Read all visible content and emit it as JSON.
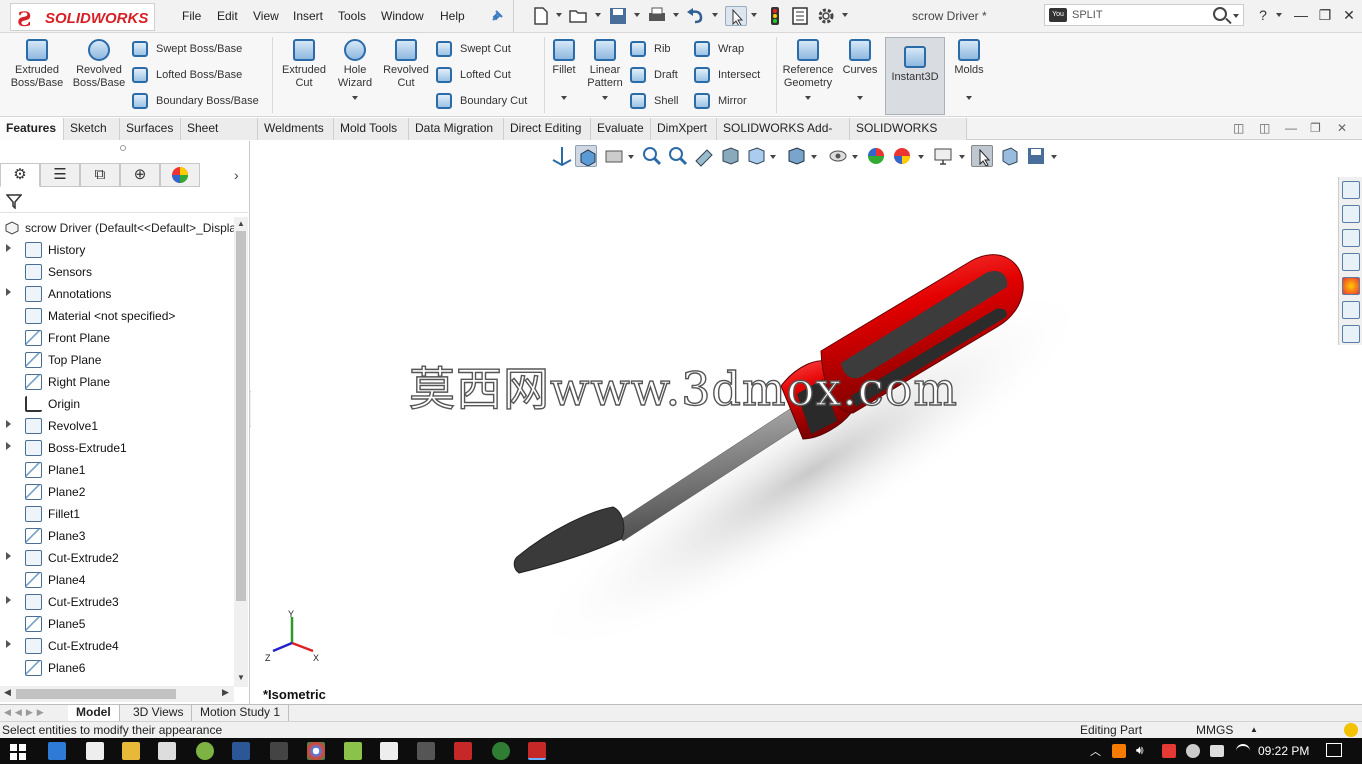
{
  "app": {
    "logo_text": "SOLIDWORKS",
    "document_title": "scrow Driver *",
    "search_placeholder": "SPLIT",
    "menu": [
      "File",
      "Edit",
      "View",
      "Insert",
      "Tools",
      "Window",
      "Help"
    ]
  },
  "ribbon": {
    "extruded_boss": "Extruded Boss/Base",
    "revolved_boss": "Revolved Boss/Base",
    "swept_boss": "Swept Boss/Base",
    "lofted_boss": "Lofted Boss/Base",
    "boundary_boss": "Boundary Boss/Base",
    "extruded_cut": "Extruded Cut",
    "hole_wizard": "Hole Wizard",
    "revolved_cut": "Revolved Cut",
    "swept_cut": "Swept Cut",
    "lofted_cut": "Lofted Cut",
    "boundary_cut": "Boundary Cut",
    "fillet": "Fillet",
    "linear_pattern": "Linear Pattern",
    "rib": "Rib",
    "draft": "Draft",
    "shell": "Shell",
    "wrap": "Wrap",
    "intersect": "Intersect",
    "mirror": "Mirror",
    "reference_geometry": "Reference Geometry",
    "curves": "Curves",
    "instant3d": "Instant3D",
    "molds": "Molds"
  },
  "cm_tabs": [
    "Features",
    "Sketch",
    "Surfaces",
    "Sheet Metal",
    "Weldments",
    "Mold Tools",
    "Data Migration",
    "Direct Editing",
    "Evaluate",
    "DimXpert",
    "SOLIDWORKS Add-Ins",
    "SOLIDWORKS MBD"
  ],
  "tree": {
    "root": "scrow Driver  (Default<<Default>_Displa",
    "items": [
      {
        "label": "History",
        "expandable": true,
        "icon": "history-icon"
      },
      {
        "label": "Sensors",
        "expandable": false,
        "icon": "sensors-icon"
      },
      {
        "label": "Annotations",
        "expandable": true,
        "icon": "annotations-icon"
      },
      {
        "label": "Material <not specified>",
        "expandable": false,
        "icon": "material-icon"
      },
      {
        "label": "Front Plane",
        "expandable": false,
        "icon": "plane-icon"
      },
      {
        "label": "Top Plane",
        "expandable": false,
        "icon": "plane-icon"
      },
      {
        "label": "Right Plane",
        "expandable": false,
        "icon": "plane-icon"
      },
      {
        "label": "Origin",
        "expandable": false,
        "icon": "origin-icon"
      },
      {
        "label": "Revolve1",
        "expandable": true,
        "icon": "revolve-icon"
      },
      {
        "label": "Boss-Extrude1",
        "expandable": true,
        "icon": "extrude-icon"
      },
      {
        "label": "Plane1",
        "expandable": false,
        "icon": "plane-icon"
      },
      {
        "label": "Plane2",
        "expandable": false,
        "icon": "plane-icon"
      },
      {
        "label": "Fillet1",
        "expandable": false,
        "icon": "fillet-icon"
      },
      {
        "label": "Plane3",
        "expandable": false,
        "icon": "plane-icon"
      },
      {
        "label": "Cut-Extrude2",
        "expandable": true,
        "icon": "cut-extrude-icon"
      },
      {
        "label": "Plane4",
        "expandable": false,
        "icon": "plane-icon"
      },
      {
        "label": "Cut-Extrude3",
        "expandable": true,
        "icon": "cut-extrude-icon"
      },
      {
        "label": "Plane5",
        "expandable": false,
        "icon": "plane-icon"
      },
      {
        "label": "Cut-Extrude4",
        "expandable": true,
        "icon": "cut-extrude-icon"
      },
      {
        "label": "Plane6",
        "expandable": false,
        "icon": "plane-icon"
      }
    ]
  },
  "viewport": {
    "watermark": "莫西网www.3dmox.com",
    "view_name": "*Isometric",
    "triad": {
      "x": "X",
      "y": "Y",
      "z": "Z"
    }
  },
  "bottom_tabs": [
    "Model",
    "3D Views",
    "Motion Study 1"
  ],
  "status": {
    "message": "Select entities to modify their appearance",
    "mode": "Editing Part",
    "units": "MMGS"
  },
  "taskbar": {
    "time": "09:22 PM"
  },
  "colors": {
    "accent_red": "#d81f26",
    "handle_red": "#e30000",
    "shaft_gray": "#8a8a8a"
  }
}
